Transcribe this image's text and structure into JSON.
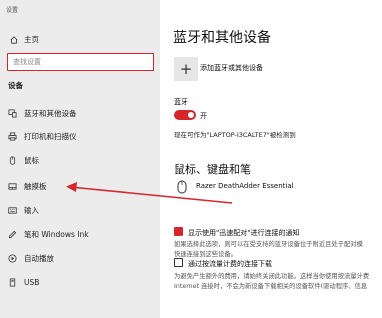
{
  "window": {
    "title": "设置"
  },
  "sidebar": {
    "home_label": "主页",
    "search_placeholder": "查找设置",
    "section_title": "设备",
    "items": [
      {
        "label": "蓝牙和其他设备",
        "icon": "bluetooth-devices-icon"
      },
      {
        "label": "打印机和扫描仪",
        "icon": "printer-icon"
      },
      {
        "label": "鼠标",
        "icon": "mouse-icon"
      },
      {
        "label": "触摸板",
        "icon": "touchpad-icon"
      },
      {
        "label": "输入",
        "icon": "keyboard-icon"
      },
      {
        "label": "笔和 Windows Ink",
        "icon": "pen-icon"
      },
      {
        "label": "自动播放",
        "icon": "autoplay-icon"
      },
      {
        "label": "USB",
        "icon": "usb-icon"
      }
    ]
  },
  "main": {
    "title": "蓝牙和其他设备",
    "add_label": "添加蓝牙或其他设备",
    "bluetooth_label": "蓝牙",
    "bluetooth_state": "开",
    "discoverable_text": "现在可作为\"LAPTOP-I3CALTE7\"被检测到",
    "section_title": "鼠标、键盘和笔",
    "device_name": "Razer DeathAdder Essential",
    "swift_pair_label": "显示使用\"迅速配对\"进行连接的通知",
    "swift_pair_desc_1": "如果选择此选项，则可以在受支持的蓝牙设备位于附近且处于配对模",
    "swift_pair_desc_2": "快速连接到这些设备。",
    "metered_label": "通过按流量计费的连接下载",
    "metered_desc_1": "为避免产生额外的费用，请始终关闭此功能。这样当你使用按流量计费",
    "metered_desc_2": "Internet 连接时，不会为新设备下载相关的设备软件(驱动程序、信息"
  },
  "colors": {
    "accent": "#d6262c",
    "sidebar_bg": "#ececec"
  }
}
